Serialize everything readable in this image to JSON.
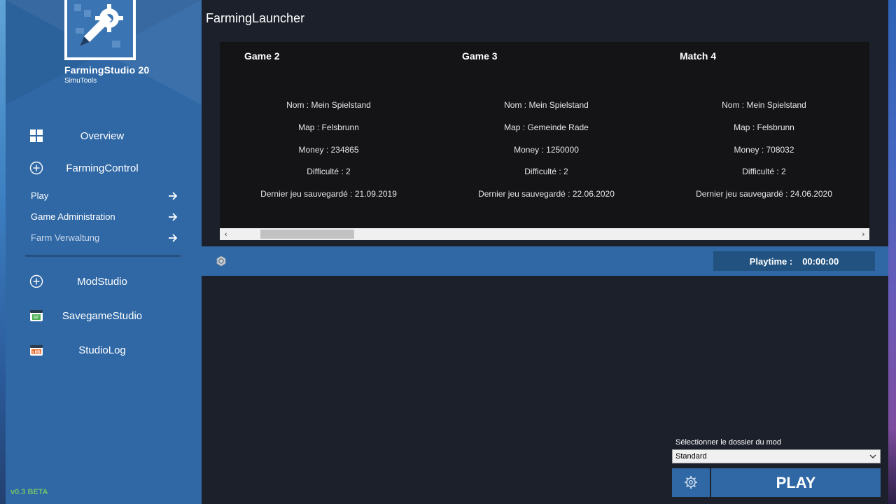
{
  "app": {
    "title": "FarmingLauncher",
    "version": "v0.3 BETA"
  },
  "logo": {
    "title": "FarmingStudio 20",
    "subtitle": "SimuTools"
  },
  "sidebar": {
    "main_items": [
      {
        "label": "Overview",
        "icon": "grid-icon"
      },
      {
        "label": "FarmingControl",
        "icon": "plus-circle-icon"
      },
      {
        "label": "ModStudio",
        "icon": "plus-circle-icon"
      },
      {
        "label": "SavegameStudio",
        "icon": "savegame-icon"
      },
      {
        "label": "StudioLog",
        "icon": "log-icon"
      }
    ],
    "sub_items": [
      {
        "label": "Play"
      },
      {
        "label": "Game Administration"
      },
      {
        "label": "Farm Verwaltung"
      }
    ]
  },
  "games": [
    {
      "name": "Game 2",
      "nom": "Nom : Mein Spielstand",
      "map": "Map : Felsbrunn",
      "money": "Money : 234865",
      "difficulty": "Difficulté : 2",
      "last_saved": "Dernier jeu sauvegardé :  21.09.2019"
    },
    {
      "name": "Game 3",
      "nom": "Nom : Mein Spielstand",
      "map": "Map : Gemeinde Rade",
      "money": "Money : 1250000",
      "difficulty": "Difficulté : 2",
      "last_saved": "Dernier jeu sauvegardé :  22.06.2020"
    },
    {
      "name": "Match 4",
      "nom": "Nom : Mein Spielstand",
      "map": "Map : Felsbrunn",
      "money": "Money : 708032",
      "difficulty": "Difficulté : 2",
      "last_saved": "Dernier jeu sauvegardé :  24.06.2020"
    }
  ],
  "status": {
    "playtime_label": "Playtime :",
    "playtime_value": "00:00:00"
  },
  "mod": {
    "label": "Sélectionner le dossier du mod",
    "selected": "Standard"
  },
  "actions": {
    "play_label": "PLAY"
  },
  "colors": {
    "sidebar": "#2f68a5",
    "window_bg": "#1c202a",
    "panel_bg": "#141416",
    "version_green": "#6fc06b"
  }
}
